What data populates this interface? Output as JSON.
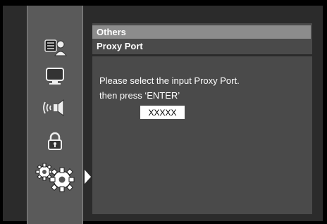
{
  "header": {
    "category": "Others",
    "item": "Proxy Port"
  },
  "sidebar": {
    "items": [
      {
        "icon": "disc-person-icon"
      },
      {
        "icon": "tv-icon"
      },
      {
        "icon": "speaker-icon"
      },
      {
        "icon": "lock-icon"
      },
      {
        "icon": "gears-icon",
        "selected": true
      }
    ]
  },
  "dialog": {
    "line1": "Please select the input Proxy Port.",
    "line2": "then press ‘ENTER’",
    "input_value": "XXXXX"
  }
}
